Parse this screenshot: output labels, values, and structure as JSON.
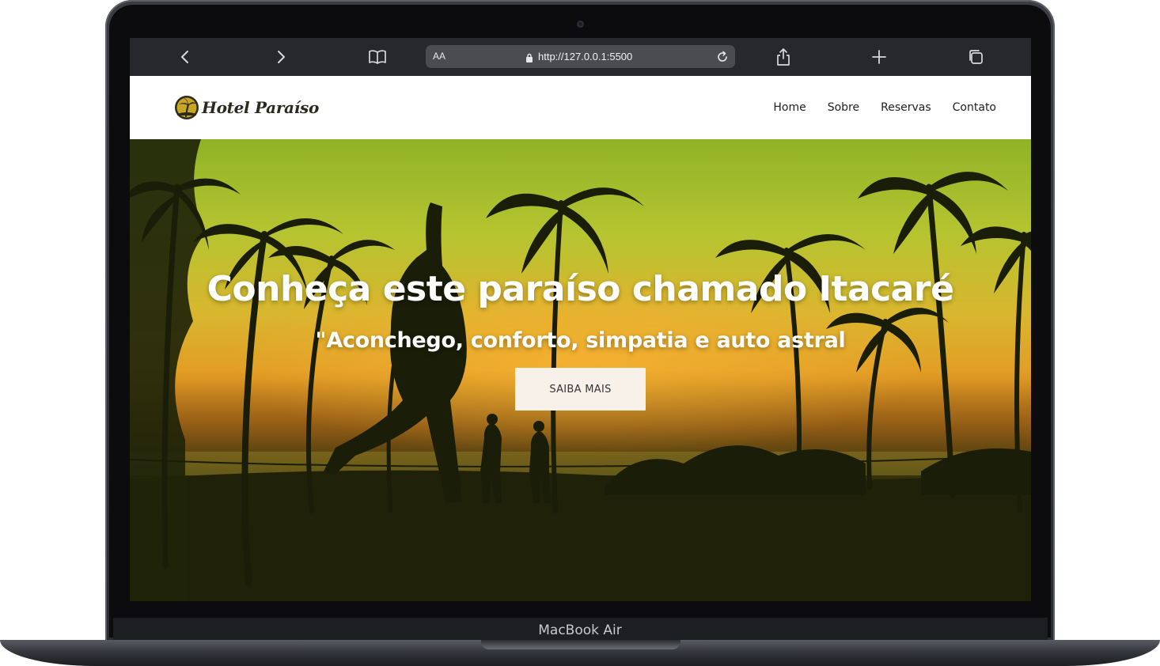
{
  "browser": {
    "url_prefix": "AA",
    "url": "http://127.0.0.1:5500",
    "icons": {
      "back": "chevron-left-icon",
      "forward": "chevron-right-icon",
      "bookmarks": "book-icon",
      "lock": "lock-icon",
      "reload": "reload-icon",
      "share": "share-icon",
      "new_tab": "plus-icon",
      "tabs": "tabs-icon"
    }
  },
  "site": {
    "logo_text": "Hotel Paraíso",
    "nav": [
      "Home",
      "Sobre",
      "Reservas",
      "Contato"
    ]
  },
  "hero": {
    "title": "Conheça este paraíso chamado Itacaré",
    "subtitle": "\"Aconchego, conforto, simpatia e auto astral",
    "button_label": "SAIBA MAIS"
  },
  "device": {
    "label": "MacBook Air"
  },
  "colors": {
    "browser_bar": "#26282d",
    "header_bg": "#ffffff",
    "hero_text": "#ffffff",
    "button_bg": "#f7f1ea",
    "sunset_orange": "#e39a24",
    "palm_silhouette": "#1f2208"
  }
}
